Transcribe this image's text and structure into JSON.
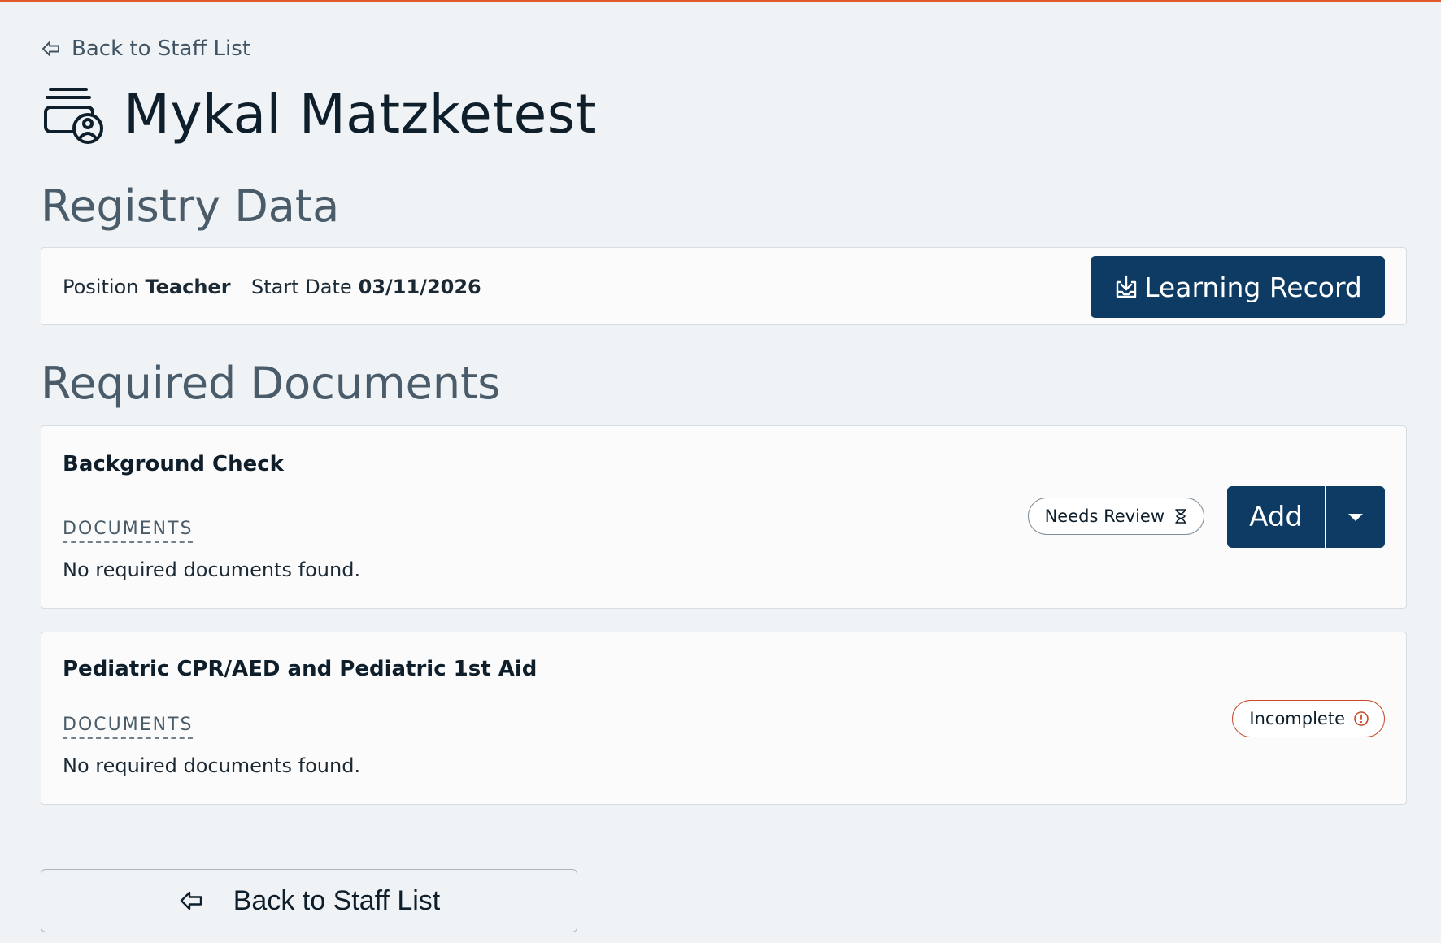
{
  "nav": {
    "back_link_label": "Back to Staff List"
  },
  "header": {
    "title": "Mykal Matzketest",
    "icon": "staff-list-person-icon"
  },
  "registry": {
    "heading": "Registry Data",
    "position_label": "Position",
    "position_value": "Teacher",
    "start_date_label": "Start Date",
    "start_date_value": "03/11/2026",
    "learning_record_label": "Learning Record",
    "learning_record_icon": "download-icon"
  },
  "required_documents": {
    "heading": "Required Documents",
    "items": [
      {
        "name": "Background Check",
        "documents_label": "DOCUMENTS",
        "empty_text": "No required documents found.",
        "status": "Needs Review",
        "status_icon": "hourglass-icon",
        "action_label": "Add"
      },
      {
        "name": "Pediatric CPR/AED and Pediatric 1st Aid",
        "documents_label": "DOCUMENTS",
        "empty_text": "No required documents found.",
        "status": "Incomplete",
        "status_icon": "alert-circle-icon"
      }
    ]
  },
  "footer": {
    "back_button_label": "Back to Staff List"
  },
  "colors": {
    "accent_top_rule": "#e05a2b",
    "primary_button": "#0d3b63",
    "incomplete_border": "#c8492a",
    "background": "#f0f3f6"
  }
}
